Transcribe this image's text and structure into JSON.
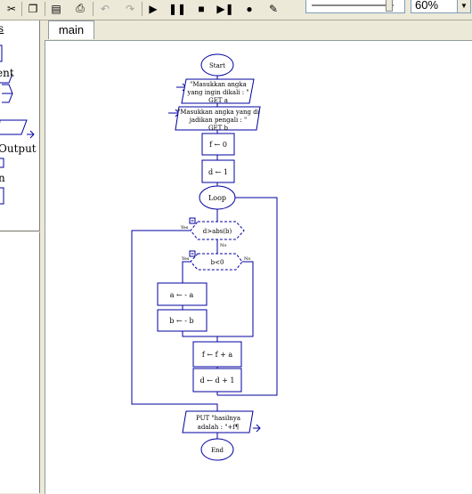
{
  "toolbar": {
    "buttons": [
      {
        "icon": "cut-icon",
        "glyph": "✂",
        "enabled": true
      },
      {
        "icon": "copy-icon",
        "glyph": "❐",
        "enabled": true
      },
      {
        "icon": "paste-icon",
        "glyph": "▤",
        "enabled": true
      },
      {
        "icon": "print-icon",
        "glyph": "⎙",
        "enabled": true
      },
      {
        "icon": "undo-icon",
        "glyph": "↶",
        "enabled": false
      },
      {
        "icon": "redo-icon",
        "glyph": "↷",
        "enabled": false
      },
      {
        "icon": "execute-icon",
        "glyph": "▶",
        "enabled": true
      },
      {
        "icon": "pause-icon",
        "glyph": "❚❚",
        "enabled": true
      },
      {
        "icon": "stop-icon",
        "glyph": "■",
        "enabled": true
      },
      {
        "icon": "step-icon",
        "glyph": "▶❚",
        "enabled": true
      },
      {
        "icon": "reset-icon",
        "glyph": "●",
        "enabled": true
      },
      {
        "icon": "pencil-icon",
        "glyph": "✎",
        "enabled": true
      }
    ],
    "zoom": "60%",
    "speed_level": 0.9
  },
  "palette": {
    "items": [
      "s",
      "ent",
      "Output",
      "n"
    ]
  },
  "tabs": [
    "main"
  ],
  "flowchart": {
    "start": "Start",
    "input1": [
      "\"Masukkan angka",
      "yang ingin dikali : \"",
      "GET a"
    ],
    "input2": [
      "\"Masukkan angka yang di",
      "jadikan pengali : \"",
      "GET b"
    ],
    "assign_f": "f ← 0",
    "assign_d": "d ← 1",
    "loop": "Loop",
    "cond1": "d>abs(b)",
    "cond2": "b<0",
    "assign_a": "a ← - a",
    "assign_b": "b ← - b",
    "assign_fa": "f ← f + a",
    "assign_dd": "d ← d + 1",
    "output": [
      "PUT \"hasilnya",
      "adalah : \"+f¶"
    ],
    "end": "End",
    "yes": "Yes",
    "no": "No"
  }
}
